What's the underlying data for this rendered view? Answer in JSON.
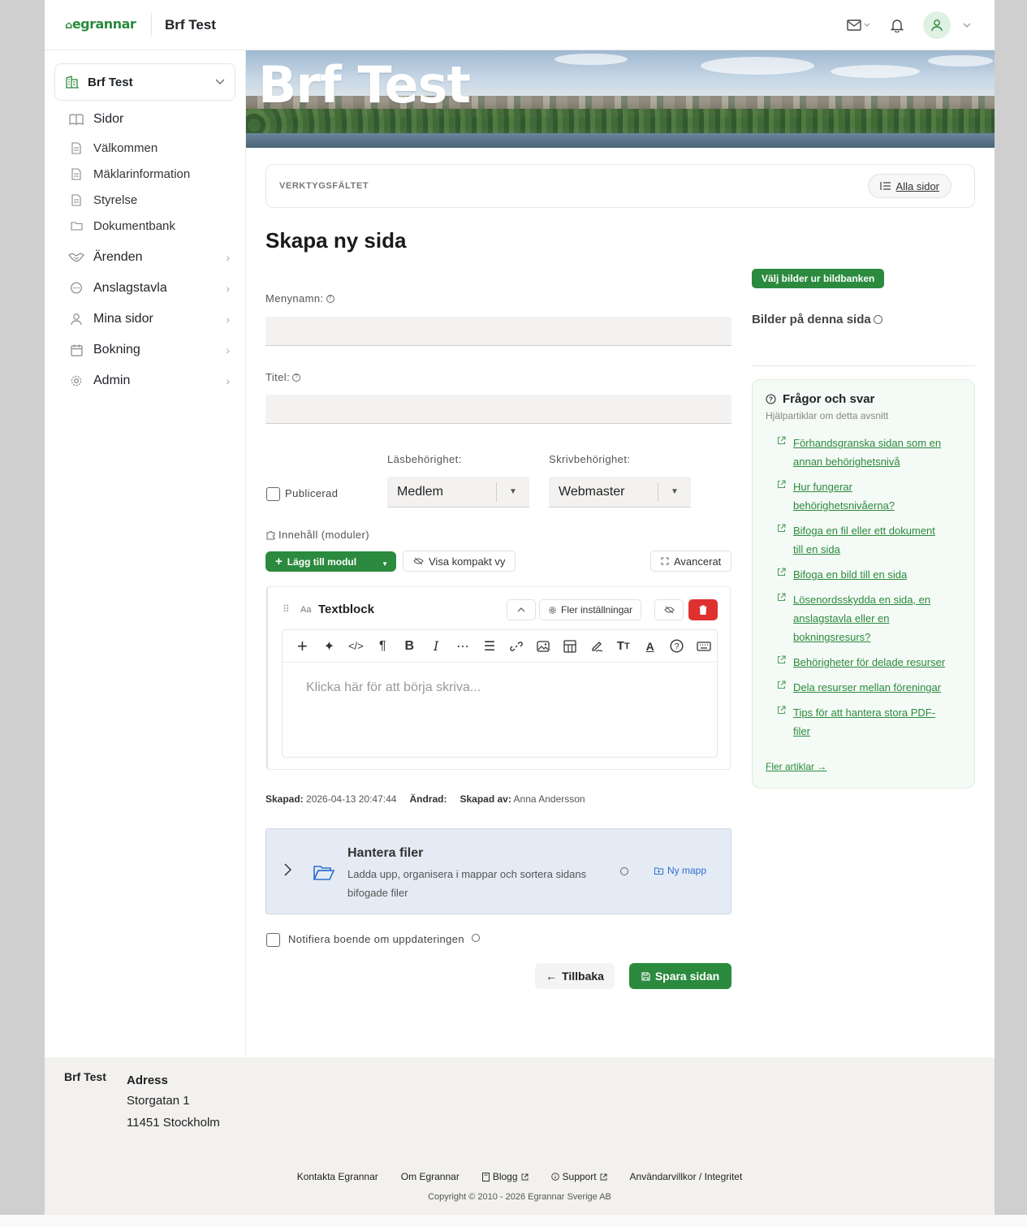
{
  "header": {
    "logo_text": "egrannar",
    "association": "Brf Test"
  },
  "sidebar": {
    "association": "Brf Test",
    "items": [
      {
        "label": "Sidor",
        "icon": "book-icon"
      },
      {
        "label": "Välkommen",
        "icon": "page-icon"
      },
      {
        "label": "Mäklarinformation",
        "icon": "page-icon"
      },
      {
        "label": "Styrelse",
        "icon": "page-icon"
      },
      {
        "label": "Dokumentbank",
        "icon": "folder-icon"
      },
      {
        "label": "Ärenden",
        "icon": "handshake-icon"
      },
      {
        "label": "Anslagstavla",
        "icon": "chat-icon"
      },
      {
        "label": "Mina sidor",
        "icon": "user-icon"
      },
      {
        "label": "Bokning",
        "icon": "calendar-icon"
      },
      {
        "label": "Admin",
        "icon": "gear-icon"
      }
    ]
  },
  "banner": {
    "title": "Brf Test"
  },
  "toolbar": {
    "label": "VERKTYGSFÄLTET",
    "all_pages": "Alla sidor"
  },
  "form": {
    "heading": "Skapa ny sida",
    "menu_name_label": "Menynamn:",
    "menu_name_value": "",
    "title_label": "Titel:",
    "title_value": "",
    "published_label": "Publicerad",
    "read_label": "Läsbehörighet:",
    "read_value": "Medlem",
    "write_label": "Skrivbehörighet:",
    "write_value": "Webmaster",
    "content_label": "Innehåll (moduler)",
    "add_module": "Lägg till modul",
    "compact_view": "Visa kompakt vy",
    "advanced": "Avancerat"
  },
  "textblock": {
    "title": "Textblock",
    "more_settings": "Fler inställningar",
    "placeholder": "Klicka här för att börja skriva..."
  },
  "meta": {
    "created_label": "Skapad:",
    "created_value": "2026-04-13 20:47:44",
    "changed_label": "Ändrad:",
    "author_label": "Skapad av:",
    "author_value": "Anna Andersson"
  },
  "files": {
    "title": "Hantera filer",
    "desc_line1": "Ladda upp, organisera i mappar och sortera sidans",
    "desc_line2": "bifogade filer",
    "new_folder": "Ny mapp"
  },
  "notify": {
    "label": "Notifiera boende om uppdateringen"
  },
  "actions": {
    "back": "Tillbaka",
    "save": "Spara sidan"
  },
  "right": {
    "choose_images": "Välj bilder ur bildbanken",
    "images_heading": "Bilder på denna sida",
    "faq_title": "Frågor och svar",
    "faq_sub": "Hjälpartiklar om detta avsnitt",
    "faq": [
      [
        "Förhandsgranska sidan som en",
        "annan behörighetsnivå"
      ],
      [
        "Hur fungerar",
        "behörighetsnivåerna?"
      ],
      [
        "Bifoga en fil eller ett dokument",
        "till en sida"
      ],
      [
        "Bifoga en bild till en sida"
      ],
      [
        "Lösenordsskydda en sida, en",
        "anslagstavla eller en",
        "bokningsresurs?"
      ],
      [
        "Behörigheter för delade resurser"
      ],
      [
        "Dela resurser mellan föreningar"
      ],
      [
        "Tips för att hantera stora PDF-",
        "filer"
      ]
    ],
    "more_articles": "Fler artiklar →"
  },
  "footer": {
    "name": "Brf Test",
    "address_heading": "Adress",
    "street": "Storgatan 1",
    "city": "11451 Stockholm",
    "links": [
      "Kontakta Egrannar",
      "Om Egrannar",
      "Blogg",
      "Support",
      "Användarvillkor / Integritet"
    ],
    "copyright": "Copyright © 2010 - 2026 Egrannar Sverige AB"
  },
  "colors": {
    "brand_green": "#2b8a3e",
    "danger": "#e03131",
    "files_bg": "#e4ebf4"
  }
}
